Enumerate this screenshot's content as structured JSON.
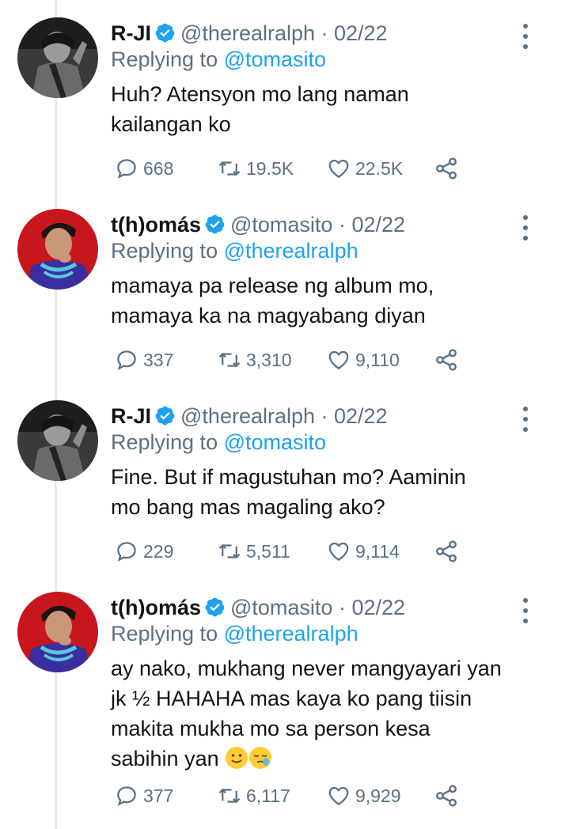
{
  "tweets": [
    {
      "name": "R-JI",
      "handle": "@therealralph · 02/22",
      "replying_prefix": "Replying to ",
      "replying_to": "@tomasito",
      "text": "Huh? Atensyon mo lang naman\nkailangan ko",
      "replies": "668",
      "retweets": "19.5K",
      "likes": "22.5K",
      "avatar_style": "grayscale"
    },
    {
      "name": "t(h)omás",
      "handle": "@tomasito · 02/22",
      "replying_prefix": "Replying to ",
      "replying_to": "@therealralph",
      "text": "mamaya pa release ng album mo,\nmamaya ka na magyabang diyan",
      "replies": "337",
      "retweets": "3,310",
      "likes": "9,110",
      "avatar_style": "red"
    },
    {
      "name": "R-JI",
      "handle": "@therealralph · 02/22",
      "replying_prefix": "Replying to ",
      "replying_to": "@tomasito",
      "text": "Fine. But if magustuhan mo? Aaminin\nmo bang mas magaling ako?",
      "replies": "229",
      "retweets": "5,511",
      "likes": "9,114",
      "avatar_style": "grayscale"
    },
    {
      "name": "t(h)omás",
      "handle": "@tomasito · 02/22",
      "replying_prefix": "Replying to ",
      "replying_to": "@therealralph",
      "text": "ay nako, mukhang never mangyayari yan\njk ½ HAHAHA mas kaya ko pang tiisin\nmakita mukha mo sa person kesa\nsabihin yan",
      "emojis": [
        "slightly-smiling-face",
        "sleepy-face"
      ],
      "replies": "377",
      "retweets": "6,117",
      "likes": "9,929",
      "avatar_style": "red"
    }
  ],
  "colors": {
    "accent": "#1da1f2",
    "secondary_text": "#5b7083",
    "thread_line": "#e6e9ec"
  },
  "icons": [
    "verified-badge-icon",
    "more-options-icon",
    "reply-icon",
    "retweet-icon",
    "like-icon",
    "share-icon"
  ]
}
